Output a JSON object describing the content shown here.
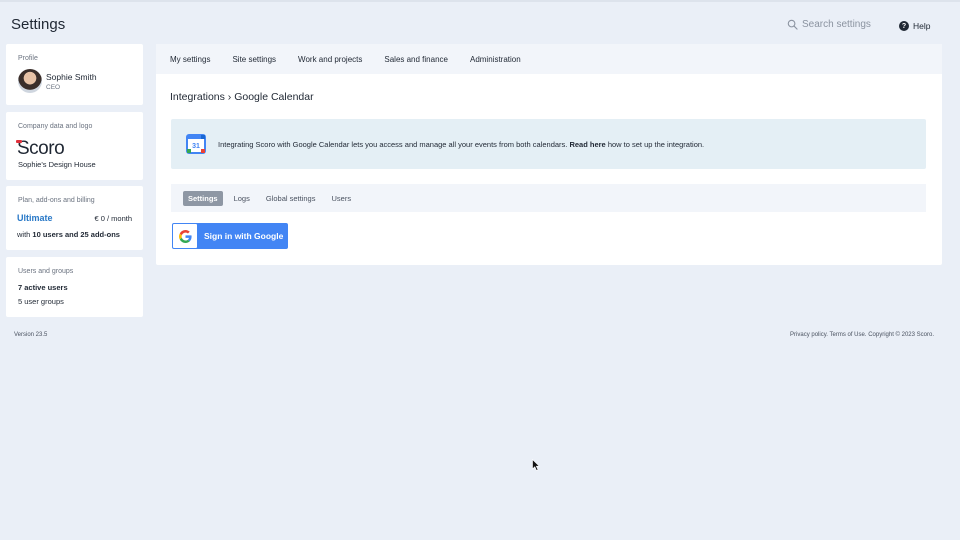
{
  "header": {
    "title": "Settings",
    "search_placeholder": "Search settings",
    "help_label": "Help"
  },
  "sidebar": {
    "profile": {
      "label": "Profile",
      "name": "Sophie Smith",
      "role": "CEO"
    },
    "company": {
      "label": "Company data and logo",
      "logo_text": "Scoro",
      "name": "Sophie's Design House"
    },
    "plan": {
      "label": "Plan, add-ons and billing",
      "name": "Ultimate",
      "price": "€ 0 / month",
      "detail_prefix": "with ",
      "detail_bold": "10 users and 25 add-ons"
    },
    "users": {
      "label": "Users and groups",
      "active": "7 active users",
      "groups": "5 user groups"
    }
  },
  "nav": {
    "items": [
      "My settings",
      "Site settings",
      "Work and projects",
      "Sales and finance",
      "Administration"
    ]
  },
  "main": {
    "breadcrumb": "Integrations › Google Calendar",
    "info": {
      "text_before": "Integrating Scoro with Google Calendar lets you access and manage all your events from both calendars. ",
      "link": "Read here",
      "text_after": " how to set up the integration.",
      "calendar_day": "31"
    },
    "subtabs": [
      "Settings",
      "Logs",
      "Global settings",
      "Users"
    ],
    "active_subtab": "Settings",
    "google_button": "Sign in with Google"
  },
  "footer": {
    "version": "Version 23.5",
    "privacy": "Privacy policy.",
    "terms": "Terms of Use.",
    "copyright": "Copyright © 2023 Scoro."
  },
  "colors": {
    "background": "#eaeff7",
    "accent_blue": "#2878c7",
    "google_blue": "#4285f4",
    "active_tab": "#8e97a4",
    "brand_red": "#e0313b"
  },
  "icons": [
    "search-icon",
    "help-icon",
    "avatar",
    "google-calendar-icon",
    "google-g-icon",
    "mouse-cursor-icon"
  ]
}
